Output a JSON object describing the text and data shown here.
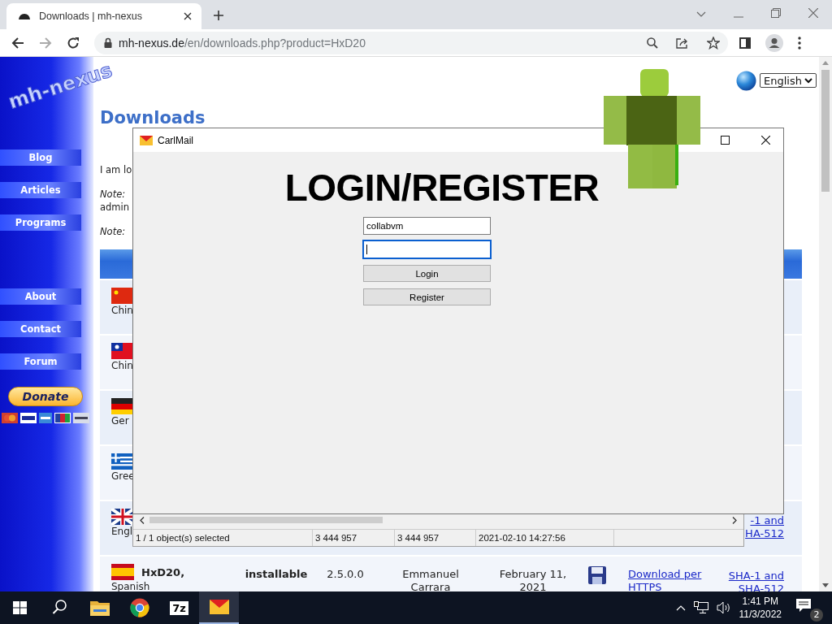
{
  "browser": {
    "tabs": [
      {
        "title": "Downloads | mh-nexus",
        "selected": true
      }
    ],
    "address": {
      "host": "mh-nexus.de",
      "path": "/en/downloads.php?product=HxD20"
    }
  },
  "page": {
    "logo": "mh-nexus",
    "nav_groups": [
      {
        "items": [
          "Blog",
          "Articles",
          "Programs"
        ]
      },
      {
        "items": [
          "About",
          "Contact",
          "Forum"
        ]
      }
    ],
    "donate": "Donate",
    "language": "English",
    "heading": "Downloads",
    "paragraphs": [
      {
        "lines": [
          {
            "text": "I am lo",
            "italic": false
          }
        ]
      },
      {
        "lines": [
          {
            "text": "Note:",
            "italic": true
          },
          {
            "text": "admin",
            "italic": false
          }
        ]
      },
      {
        "lines": [
          {
            "text": "Note:",
            "italic": true
          }
        ]
      }
    ],
    "rows": [
      {
        "kind": "cn",
        "language": "Chin"
      },
      {
        "kind": "tw",
        "language": "Chin"
      },
      {
        "kind": "de",
        "language": "Ger"
      },
      {
        "kind": "gr",
        "language": "Gree"
      },
      {
        "kind": "gb",
        "language": "Engl",
        "hash_lines": [
          "-1 and",
          "HA-512"
        ]
      },
      {
        "kind": "es",
        "product": "HxD20,",
        "language": "Spanish",
        "type": "installable",
        "version": "2.5.0.0",
        "author": "Emmanuel Carrara",
        "date": "February 11, 2021",
        "download": "Download per HTTPS",
        "hash_lines": [
          "SHA-1 and",
          "SHA-512"
        ]
      }
    ]
  },
  "mail_window": {
    "title": "CarlMail",
    "heading": "LOGIN/REGISTER",
    "username": "collabvm",
    "password": {
      "focused": true
    },
    "buttons": [
      "Login",
      "Register"
    ]
  },
  "archive_window": {
    "status": [
      "1 / 1 object(s) selected",
      "3 444 957",
      "3 444 957",
      "2021-02-10 14:27:56"
    ]
  },
  "taskbar": {
    "apps": [
      {
        "kind": "explorer",
        "active": false
      },
      {
        "kind": "chrome",
        "active": false
      },
      {
        "kind": "sevenzip",
        "label": "7z",
        "active": false
      },
      {
        "kind": "mail",
        "active": true
      }
    ],
    "time": "1:41 PM",
    "date": "11/3/2022",
    "notifications": "2"
  }
}
